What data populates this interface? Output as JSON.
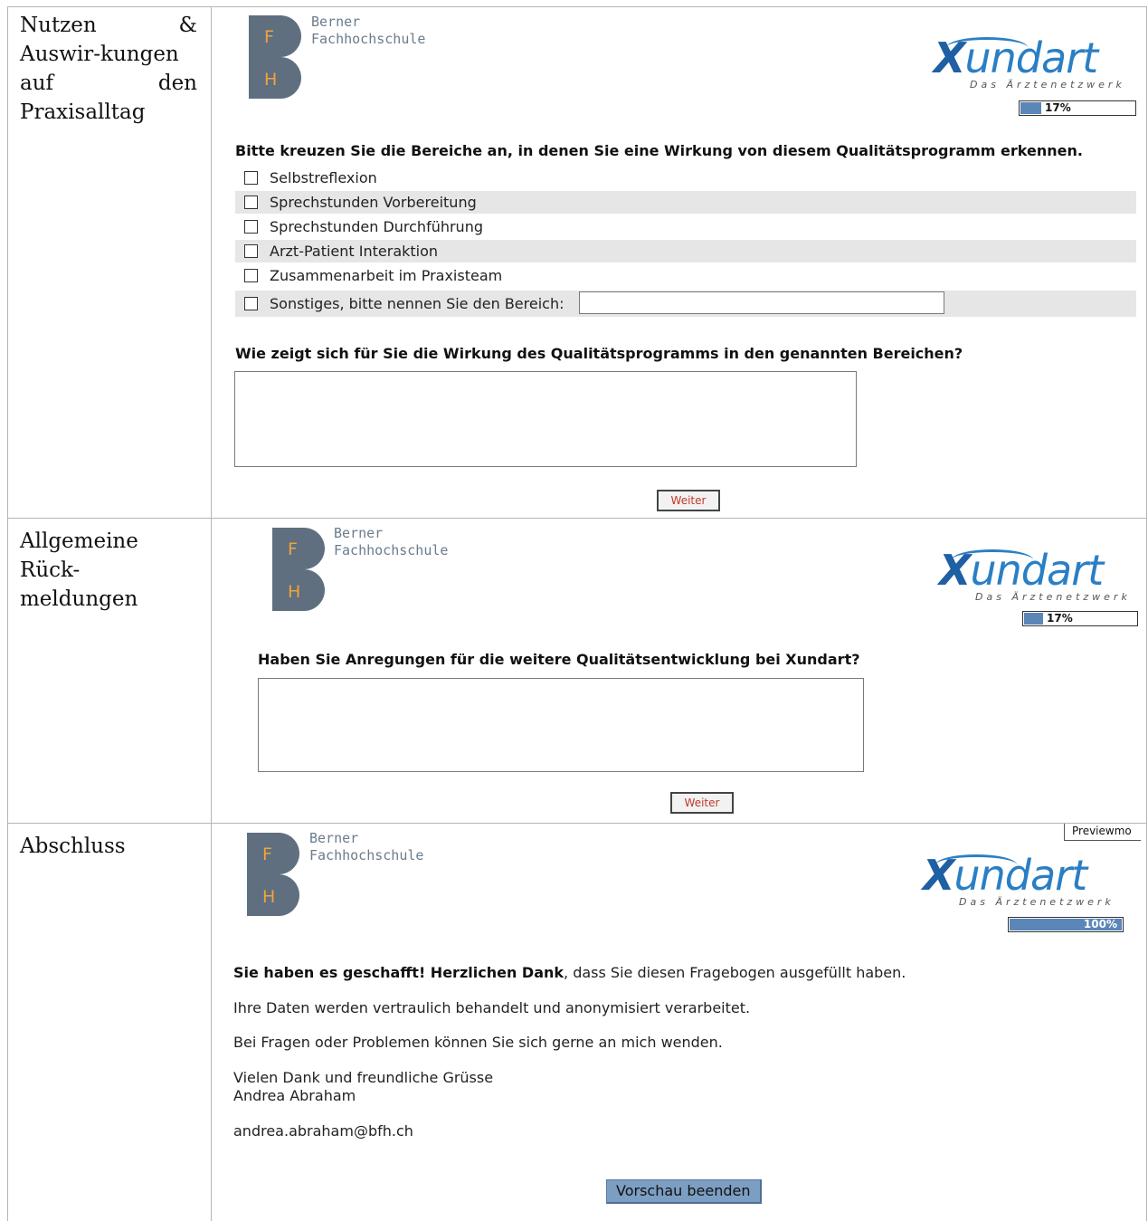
{
  "rows": [
    {
      "label": "Nutzen & Auswir-kungen auf den Praxisalltag"
    },
    {
      "label": "Allgemeine Rück-meldungen"
    },
    {
      "label": "Abschluss"
    }
  ],
  "logos": {
    "fh_letters": [
      "F",
      "H"
    ],
    "fh_text": [
      "Berner",
      "Fachhochschule"
    ],
    "xundart_word": "undart",
    "xundart_initial": "X",
    "xundart_sub": "Das Ärztenetzwerk"
  },
  "page1": {
    "progress": {
      "percent": 17,
      "label": "17%"
    },
    "question1": "Bitte kreuzen Sie die Bereiche an, in denen Sie eine Wirkung von diesem Qualitätsprogramm erkennen.",
    "options": [
      "Selbstreflexion",
      "Sprechstunden Vorbereitung",
      "Sprechstunden Durchführung",
      "Arzt-Patient Interaktion",
      "Zusammenarbeit im Praxisteam",
      "Sonstiges, bitte nennen Sie den Bereich:"
    ],
    "question2": "Wie zeigt sich für Sie die Wirkung des Qualitätsprogramms in den genannten Bereichen?",
    "next_label": "Weiter"
  },
  "page2": {
    "progress": {
      "percent": 17,
      "label": "17%"
    },
    "question": "Haben Sie Anregungen für die weitere Qualitätsentwicklung bei Xundart?",
    "next_label": "Weiter"
  },
  "page3": {
    "preview_tag": "Previewmo",
    "progress": {
      "percent": 100,
      "label": "100%"
    },
    "thanks_bold": "Sie haben es geschafft! Herzlichen Dank",
    "thanks_rest": ", dass Sie diesen Fragebogen ausgefüllt haben.",
    "privacy": "Ihre Daten werden vertraulich behandelt und anonymisiert verarbeitet.",
    "contact": "Bei Fragen oder Problemen können Sie sich gerne an mich wenden.",
    "closing": "Vielen Dank und freundliche Grüsse",
    "name": "Andrea Abraham",
    "email": "andrea.abraham@bfh.ch",
    "end_label": "Vorschau beenden"
  }
}
